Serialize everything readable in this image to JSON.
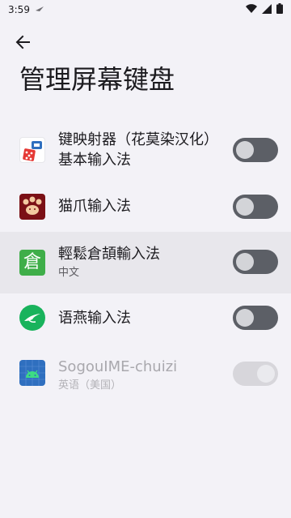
{
  "status_bar": {
    "time": "3:59",
    "icons": [
      "notification-icon",
      "wifi-icon",
      "signal-icon",
      "battery-icon"
    ]
  },
  "header": {
    "back_icon": "arrow-back-icon",
    "title": "管理屏幕键盘"
  },
  "keyboards": [
    {
      "title": "键映射器（花莫染汉化）基本输入法",
      "subtitle": "",
      "enabled": false,
      "disabled": false,
      "highlighted": false,
      "icon": "key-mapper-icon"
    },
    {
      "title": "猫爪输入法",
      "subtitle": "",
      "enabled": false,
      "disabled": false,
      "highlighted": false,
      "icon": "cat-paw-icon"
    },
    {
      "title": "輕鬆倉頡輸入法",
      "subtitle": "中文",
      "enabled": false,
      "disabled": false,
      "highlighted": true,
      "icon": "cangjie-icon"
    },
    {
      "title": "语燕输入法",
      "subtitle": "",
      "enabled": false,
      "disabled": false,
      "highlighted": false,
      "icon": "swallow-icon"
    },
    {
      "title": "SogouIME-chuizi",
      "subtitle": "英语（美国）",
      "enabled": true,
      "disabled": true,
      "highlighted": false,
      "icon": "android-icon"
    }
  ],
  "colors": {
    "background": "#f3f2f7",
    "highlight": "#e8e7ec",
    "toggle_off": "#5c5f66",
    "cangjie_green": "#3fae49",
    "swallow_green": "#19b35c",
    "android_blue": "#2f6fbf"
  }
}
